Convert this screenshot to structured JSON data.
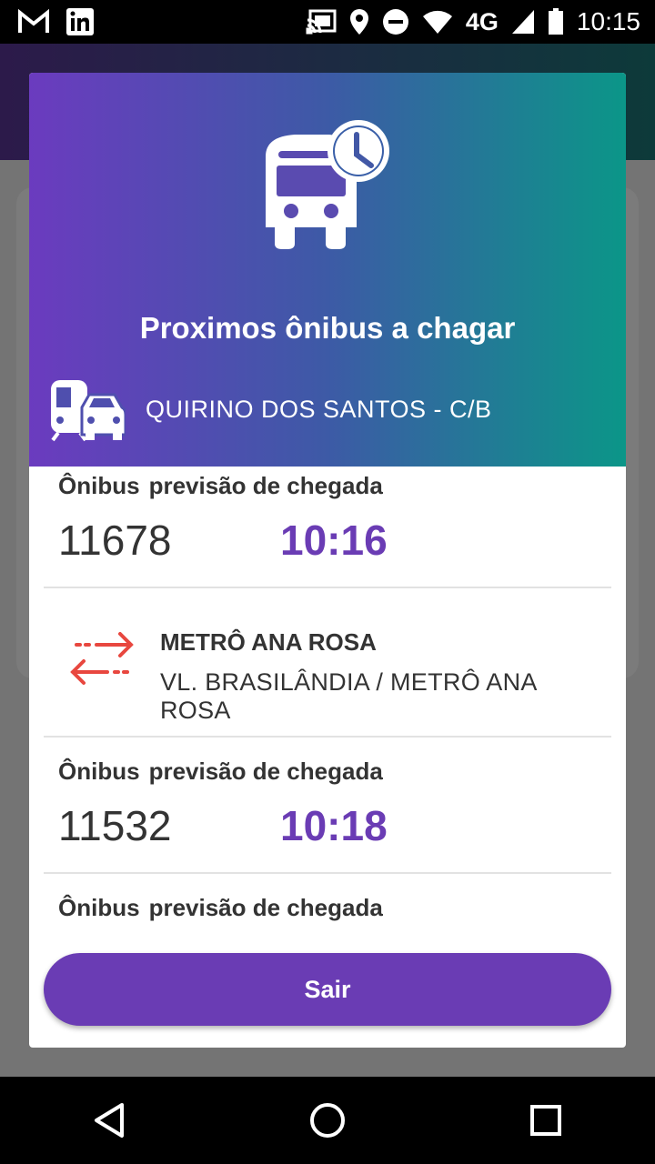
{
  "status_bar": {
    "network": "4G",
    "time": "10:15",
    "icons": [
      "gmail-icon",
      "linkedin-icon",
      "cast-icon",
      "location-icon",
      "dnd-icon",
      "wifi-icon",
      "signal-icon",
      "battery-icon"
    ]
  },
  "dialog": {
    "header_icon": "bus-clock-icon",
    "title": "Proximos ônibus a chagar",
    "stop_icon": "metro-car-icon",
    "stop_name": "QUIRINO DOS SANTOS - C/B",
    "arrival_header": {
      "bus_label": "Ônibus",
      "forecast_label": "previsão de chegada"
    },
    "arrivals": [
      {
        "bus": "11678",
        "time": "10:16"
      },
      {
        "bus": "11532",
        "time": "10:18"
      }
    ],
    "route": {
      "icon": "swap-arrows-icon",
      "name": "METRÔ ANA ROSA",
      "description": "VL. BRASILÂNDIA / METRÔ ANA ROSA"
    },
    "exit_label": "Sair"
  },
  "colors": {
    "accent": "#6a3cb4",
    "header_gradient": [
      "#6b3bbf",
      "#0b9688"
    ],
    "route_icon": "#e8473f"
  }
}
